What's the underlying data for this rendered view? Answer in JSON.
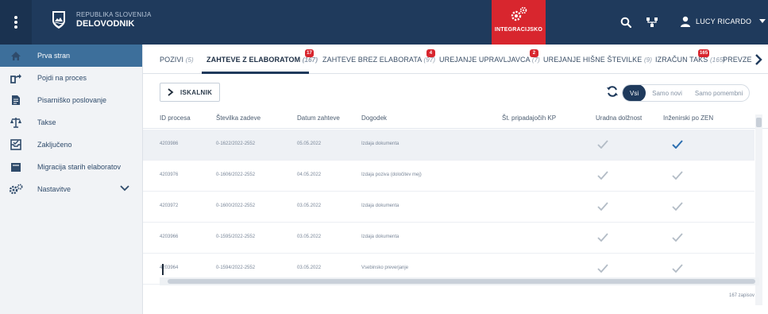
{
  "header": {
    "org_small": "REPUBLIKA SLOVENIJA",
    "app_name": "DELOVODNIK",
    "integration_label": "INTEGRACIJSKO",
    "user_name": "LUCY RICARDO",
    "colors": {
      "bar": "#1f3a5c",
      "integration": "#d8262e"
    }
  },
  "sidebar": {
    "items": [
      {
        "label": "Prva stran",
        "icon": "home-icon",
        "active": true
      },
      {
        "label": "Pojdi na proces",
        "icon": "share-icon"
      },
      {
        "label": "Pisarniško poslovanje",
        "icon": "document-icon"
      },
      {
        "label": "Takse",
        "icon": "scales-icon"
      },
      {
        "label": "Zaključeno",
        "icon": "archive-icon"
      },
      {
        "label": "Migracija starih elaboratov",
        "icon": "migration-icon"
      },
      {
        "label": "Nastavitve",
        "icon": "settings-icon"
      }
    ]
  },
  "tabs": [
    {
      "label": "POZIVI",
      "count": "(5)"
    },
    {
      "label": "ZAHTEVE Z ELABORATOM",
      "count": "(167)",
      "badge": "17",
      "active": true
    },
    {
      "label": "ZAHTEVE BREZ ELABORATA",
      "count": "(97)",
      "badge": "4"
    },
    {
      "label": "UREJANJE UPRAVLJAVCA",
      "count": "(7)",
      "badge": "2"
    },
    {
      "label": "UREJANJE HIŠNE ŠTEVILKE",
      "count": "(9)"
    },
    {
      "label": "IZRAČUN TAKS",
      "count": "(165)",
      "badge": "165"
    },
    {
      "label": "PREVZE",
      "count": ""
    }
  ],
  "toolbar": {
    "search_label": "ISKALNIK",
    "filters": [
      "Vsi",
      "Samo novi",
      "Samo pomembni"
    ]
  },
  "table": {
    "columns": [
      "ID procesa",
      "Številka zadeve",
      "Datum zahteve",
      "Dogodek",
      "Št. pripadajočih KP",
      "Uradna dolžnost",
      "Inženirski po ZEN"
    ],
    "rows": [
      {
        "id": "4203986",
        "case": "0-1622/2022-2552",
        "date": "05.05.2022",
        "event": "Izdaja dokumenta",
        "kp": "",
        "official": true,
        "engineering": true,
        "engineering_highlight": true
      },
      {
        "id": "4203976",
        "case": "0-1606/2022-2552",
        "date": "04.05.2022",
        "event": "Izdaja poziva (določitev mej)",
        "kp": "",
        "official": true,
        "engineering": true
      },
      {
        "id": "4203972",
        "case": "0-1600/2022-2552",
        "date": "03.05.2022",
        "event": "Izdaja dokumenta",
        "kp": "",
        "official": true,
        "engineering": true
      },
      {
        "id": "4203966",
        "case": "0-1595/2022-2552",
        "date": "03.05.2022",
        "event": "Izdaja dokumenta",
        "kp": "",
        "official": true,
        "engineering": true
      },
      {
        "id": "4203964",
        "case": "0-1594/2022-2552",
        "date": "03.05.2022",
        "event": "Vsebinsko preverjanje",
        "kp": "",
        "official": true,
        "engineering": true
      }
    ],
    "record_count": "167 zapisov"
  }
}
